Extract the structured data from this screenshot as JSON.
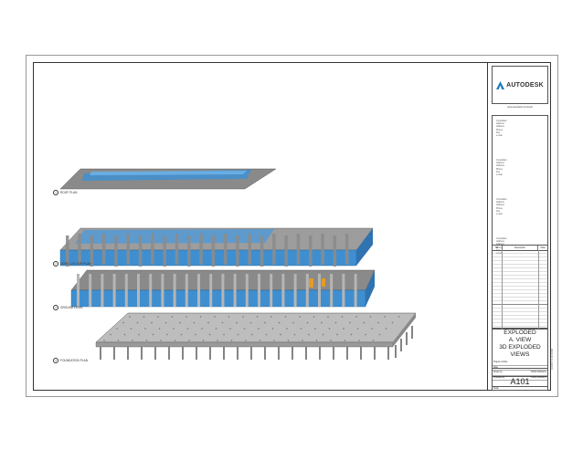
{
  "titleblock": {
    "logo_text": "AUTODESK",
    "owner": "www.autodesk.com/revit",
    "consultants": [
      [
        "Consultant",
        "Address",
        "Address",
        "Phone",
        "Fax",
        "e-mail"
      ],
      [
        "Consultant",
        "Address",
        "Address",
        "Phone",
        "Fax",
        "e-mail"
      ],
      [
        "Consultant",
        "Address",
        "Address",
        "Phone",
        "Fax",
        "e-mail"
      ],
      [
        "Consultant",
        "Address",
        "Address",
        "Phone",
        "Fax",
        "e-mail"
      ]
    ],
    "rev_headers": [
      "No.",
      "Description",
      "Date"
    ],
    "title_lines": [
      "EXPLODED",
      "A. VIEW",
      "3D EXPLODED",
      "VIEWS"
    ],
    "info": [
      {
        "label": "Project number",
        "value": ""
      },
      {
        "label": "Date",
        "value": ""
      },
      {
        "label": "Drawn by",
        "value": "TODD MORGOV"
      },
      {
        "label": "Checked by",
        "value": "TODD MORGOV"
      }
    ],
    "sheet_number": "A101",
    "scale": "Scale",
    "side_stamp": "10/2/2017 2:14:04 PM"
  },
  "views": [
    {
      "id": "roof",
      "label": "ROOF PLAN",
      "number": "1"
    },
    {
      "id": "level1",
      "label": "LEVEL 1 FLOOR PLAN",
      "number": "2"
    },
    {
      "id": "ground",
      "label": "GROUND LEVEL",
      "number": "3"
    },
    {
      "id": "foundation",
      "label": "FOUNDATION PLAN",
      "number": "4"
    }
  ],
  "colors": {
    "glass": "#3f8fd0",
    "glass_dark": "#1f5f9a",
    "slab": "#7a7a7a",
    "column": "#9a9a9a",
    "accent": "#e39b2a",
    "logo": "#1a7bbf"
  }
}
